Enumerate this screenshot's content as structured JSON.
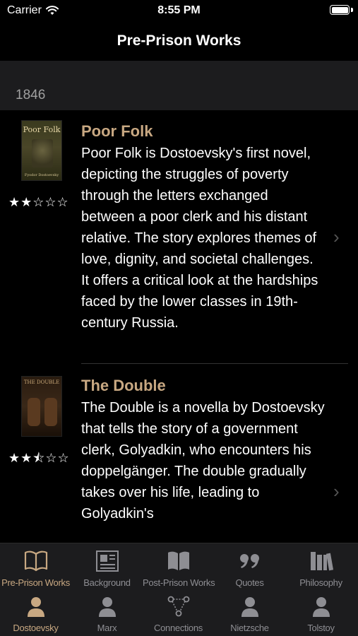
{
  "status_bar": {
    "carrier": "Carrier",
    "time": "8:55 PM"
  },
  "nav": {
    "title": "Pre-Prison Works"
  },
  "section": {
    "title": "1846"
  },
  "works": [
    {
      "title": "Poor Folk",
      "cover_text": "Poor Folk",
      "cover_author": "Fyodor Dostoevsky",
      "rating": 2,
      "stars": "★★☆☆☆",
      "description": "Poor Folk is Dostoevsky's first novel, depicting the struggles of poverty through the letters exchanged between a poor clerk and his distant relative. The story explores themes of love, dignity, and societal challenges. It offers a critical look at the hardships faced by the lower classes in 19th-century Russia."
    },
    {
      "title": "The Double",
      "cover_text": "THE DOUBLE",
      "rating": 2.5,
      "stars": "★★⯪☆☆",
      "description": "The Double is a novella by Dostoevsky that tells the story of a government clerk, Golyadkin, who encounters his doppelgänger. The double gradually takes over his life, leading to Golyadkin's"
    }
  ],
  "tabs_top": [
    {
      "label": "Pre-Prison Works",
      "icon": "book-open-icon",
      "active": true
    },
    {
      "label": "Background",
      "icon": "newspaper-icon",
      "active": false
    },
    {
      "label": "Post-Prison Works",
      "icon": "book-closed-icon",
      "active": false
    },
    {
      "label": "Quotes",
      "icon": "quote-icon",
      "active": false
    },
    {
      "label": "Philosophy",
      "icon": "books-icon",
      "active": false
    }
  ],
  "tabs_bottom": [
    {
      "label": "Dostoevsky",
      "icon": "person-icon",
      "active": true
    },
    {
      "label": "Marx",
      "icon": "person-icon",
      "active": false
    },
    {
      "label": "Connections",
      "icon": "network-icon",
      "active": false
    },
    {
      "label": "Nietzsche",
      "icon": "person-icon",
      "active": false
    },
    {
      "label": "Tolstoy",
      "icon": "person-icon",
      "active": false
    }
  ],
  "colors": {
    "accent": "#c8a882",
    "inactive": "#8e8e93",
    "background": "#000000",
    "bar": "#1c1c1e"
  }
}
